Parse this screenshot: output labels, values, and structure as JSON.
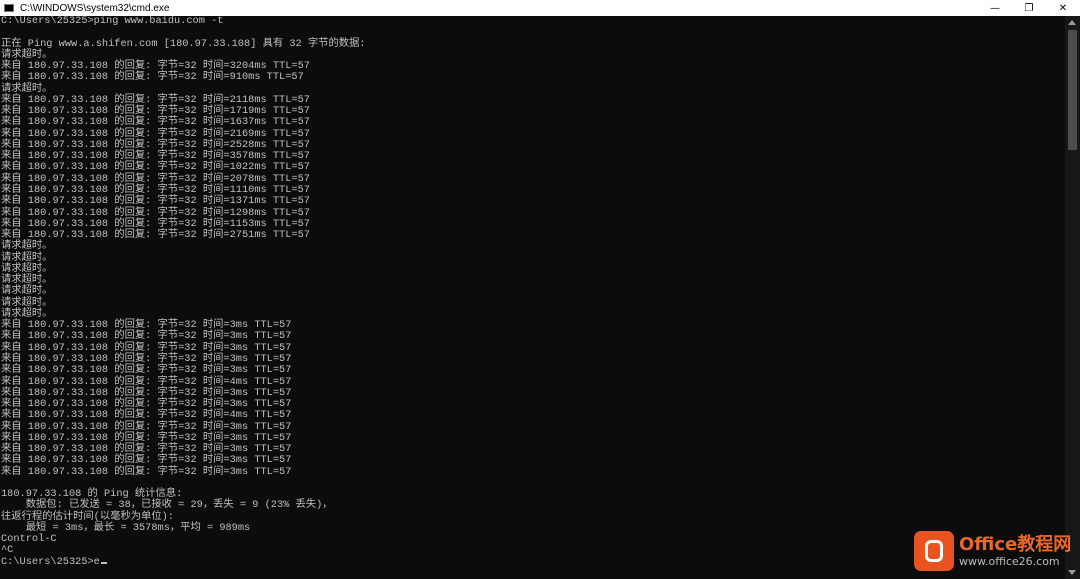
{
  "window": {
    "title": "C:\\WINDOWS\\system32\\cmd.exe",
    "controls": {
      "minimize": "—",
      "maximize": "❐",
      "close": "✕"
    }
  },
  "console": {
    "lines": [
      "C:\\Users\\25325>ping www.baidu.com -t",
      "",
      "正在 Ping www.a.shifen.com [180.97.33.108] 具有 32 字节的数据:",
      "请求超时。",
      "来自 180.97.33.108 的回复: 字节=32 时间=3204ms TTL=57",
      "来自 180.97.33.108 的回复: 字节=32 时间=910ms TTL=57",
      "请求超时。",
      "来自 180.97.33.108 的回复: 字节=32 时间=2118ms TTL=57",
      "来自 180.97.33.108 的回复: 字节=32 时间=1719ms TTL=57",
      "来自 180.97.33.108 的回复: 字节=32 时间=1637ms TTL=57",
      "来自 180.97.33.108 的回复: 字节=32 时间=2169ms TTL=57",
      "来自 180.97.33.108 的回复: 字节=32 时间=2528ms TTL=57",
      "来自 180.97.33.108 的回复: 字节=32 时间=3578ms TTL=57",
      "来自 180.97.33.108 的回复: 字节=32 时间=1022ms TTL=57",
      "来自 180.97.33.108 的回复: 字节=32 时间=2078ms TTL=57",
      "来自 180.97.33.108 的回复: 字节=32 时间=1110ms TTL=57",
      "来自 180.97.33.108 的回复: 字节=32 时间=1371ms TTL=57",
      "来自 180.97.33.108 的回复: 字节=32 时间=1298ms TTL=57",
      "来自 180.97.33.108 的回复: 字节=32 时间=1153ms TTL=57",
      "来自 180.97.33.108 的回复: 字节=32 时间=2751ms TTL=57",
      "请求超时。",
      "请求超时。",
      "请求超时。",
      "请求超时。",
      "请求超时。",
      "请求超时。",
      "请求超时。",
      "来自 180.97.33.108 的回复: 字节=32 时间=3ms TTL=57",
      "来自 180.97.33.108 的回复: 字节=32 时间=3ms TTL=57",
      "来自 180.97.33.108 的回复: 字节=32 时间=3ms TTL=57",
      "来自 180.97.33.108 的回复: 字节=32 时间=3ms TTL=57",
      "来自 180.97.33.108 的回复: 字节=32 时间=3ms TTL=57",
      "来自 180.97.33.108 的回复: 字节=32 时间=4ms TTL=57",
      "来自 180.97.33.108 的回复: 字节=32 时间=3ms TTL=57",
      "来自 180.97.33.108 的回复: 字节=32 时间=3ms TTL=57",
      "来自 180.97.33.108 的回复: 字节=32 时间=4ms TTL=57",
      "来自 180.97.33.108 的回复: 字节=32 时间=3ms TTL=57",
      "来自 180.97.33.108 的回复: 字节=32 时间=3ms TTL=57",
      "来自 180.97.33.108 的回复: 字节=32 时间=3ms TTL=57",
      "来自 180.97.33.108 的回复: 字节=32 时间=3ms TTL=57",
      "来自 180.97.33.108 的回复: 字节=32 时间=3ms TTL=57",
      "",
      "180.97.33.108 的 Ping 统计信息:",
      "    数据包: 已发送 = 38，已接收 = 29，丢失 = 9 (23% 丢失)，",
      "往返行程的估计时间(以毫秒为单位):",
      "    最短 = 3ms，最长 = 3578ms，平均 = 989ms",
      "Control-C",
      "^C"
    ],
    "prompt": "C:\\Users\\25325>e"
  },
  "watermark": {
    "name": "Office教程网",
    "site": "www.office26.com"
  },
  "colors": {
    "console_bg": "#0c0c0c",
    "console_text": "#c0c0c0",
    "watermark_orange": "#e8531f"
  }
}
